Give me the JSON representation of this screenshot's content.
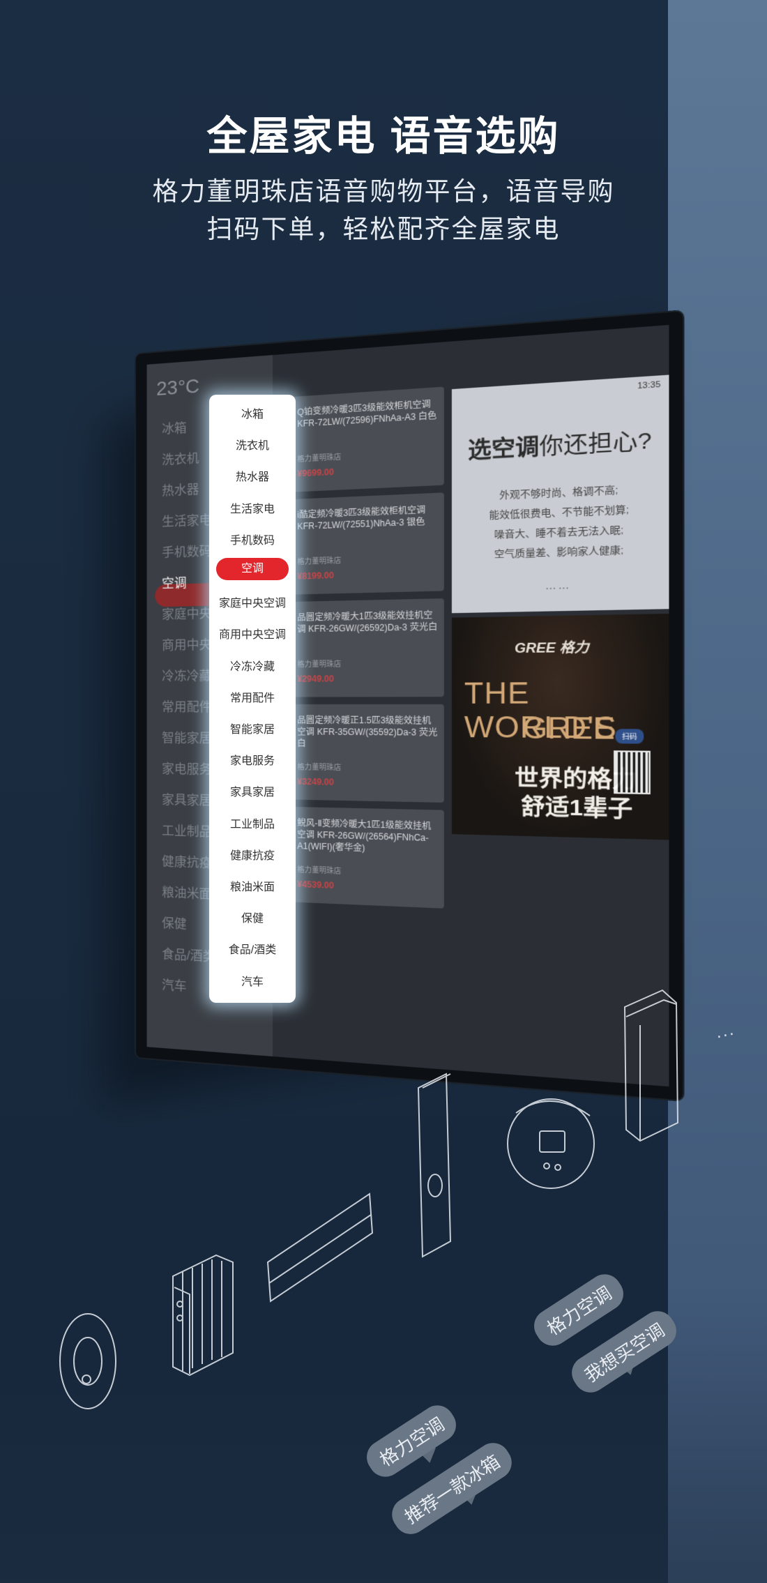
{
  "header": {
    "title": "全屋家电 语音选购",
    "subtitle_line1": "格力董明珠店语音购物平台，语音导购",
    "subtitle_line2": "扫码下单，轻松配齐全屋家电"
  },
  "tv": {
    "temperature": "23°C",
    "categories": [
      "冰箱",
      "洗衣机",
      "热水器",
      "生活家电",
      "手机数码",
      "空调",
      "家庭中央空调",
      "商用中央空调",
      "冷冻冷藏",
      "常用配件",
      "智能家居",
      "家电服务",
      "家具家居",
      "工业制品",
      "健康抗疫",
      "粮油米面",
      "保健",
      "食品/酒类",
      "汽车"
    ],
    "selected_category": "空调",
    "products": [
      {
        "title": "Q铂变频冷暖3匹3级能效柜机空调 KFR-72LW/(72596)FNhAa-A3 白色",
        "shop": "格力董明珠店",
        "price": "¥9699.00"
      },
      {
        "title": "i酷定频冷暖3匹3级能效柜机空调 KFR-72LW/(72551)NhAa-3 银色",
        "shop": "格力董明珠店",
        "price": "¥8199.00"
      },
      {
        "title": "品圆定频冷暖大1匹3级能效挂机空调 KFR-26GW/(26592)Da-3 荧光白",
        "shop": "格力董明珠店",
        "price": "¥2949.00"
      },
      {
        "title": "品圆定频冷暖正1.5匹3级能效挂机空调 KFR-35GW/(35592)Da-3 荧光白",
        "shop": "格力董明珠店",
        "price": "¥3249.00"
      },
      {
        "title": "鲵风-Ⅱ变频冷暖大1匹1级能效挂机空调 KFR-26GW/(26564)FNhCa-A1(WIFI)(奢华金)",
        "shop": "格力董明珠店",
        "price": "¥4539.00"
      }
    ],
    "promo": {
      "status": "13:35",
      "headline_bold": "选空调",
      "headline_rest": "你还担心?",
      "lines": [
        "外观不够时尚、格调不高;",
        "能效低很费电、不节能不划算;",
        "噪音大、睡不着去无法入眠;",
        "空气质量差、影响家人健康;"
      ],
      "dots": "……"
    },
    "ad": {
      "logo": "GREE 格力",
      "headline1": "THE WORLD'S",
      "headline2": "GREE",
      "slogan1": "世界的格力",
      "slogan2": "舒适1辈子",
      "tag": "扫码"
    }
  },
  "voice_bubbles": [
    "格力空调",
    "我想买空调",
    "格力空调",
    "推荐一款冰箱"
  ],
  "ellipsis": "...",
  "colors": {
    "accent_red": "#e2262b",
    "wall": "#1b2d42",
    "price_red": "#c84346"
  }
}
